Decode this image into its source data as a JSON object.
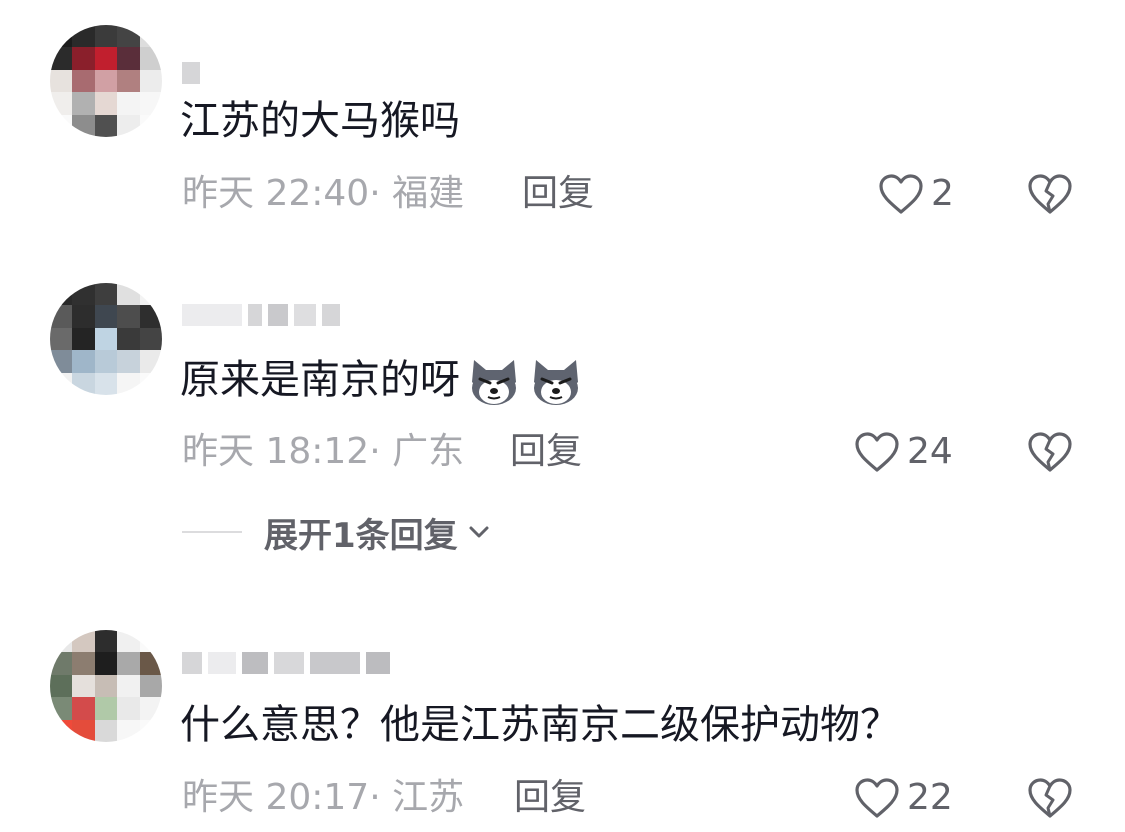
{
  "comments": [
    {
      "text": "江苏的大马猴吗",
      "time": "昨天 22:40",
      "location": "· 福建",
      "reply_label": "回复",
      "likes": "2"
    },
    {
      "text": "原来是南京的呀",
      "emoji": [
        "husky-emoji",
        "husky-emoji"
      ],
      "time": "昨天 18:12",
      "location": "· 广东",
      "reply_label": "回复",
      "likes": "24",
      "expand_label": "展开1条回复"
    },
    {
      "text": "什么意思？他是江苏南京二级保护动物？",
      "time": "昨天 20:17",
      "location": "· 江苏",
      "reply_label": "回复",
      "likes": "22"
    }
  ],
  "icons": {
    "like": "heart-outline-icon",
    "dislike": "broken-heart-icon",
    "expand": "chevron-down-icon"
  },
  "colors": {
    "text": "#161823",
    "meta": "#a7a8ad",
    "action": "#616269"
  }
}
